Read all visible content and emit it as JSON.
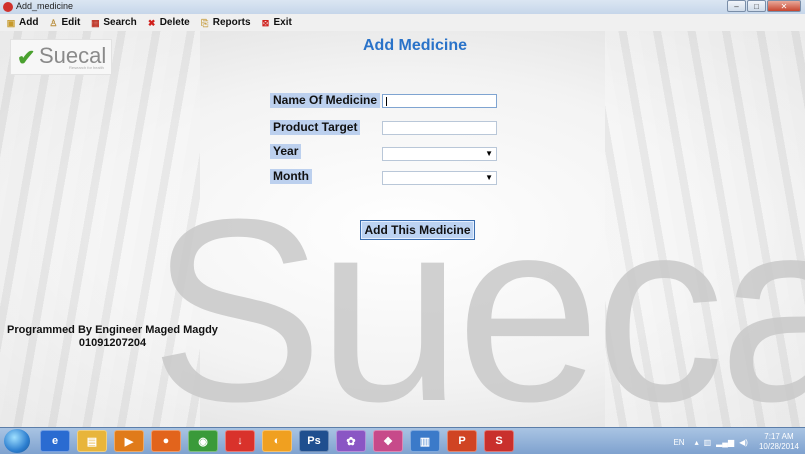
{
  "window": {
    "title": "Add_medicine",
    "controls": {
      "minimize": "–",
      "maximize": "□",
      "close": "✕"
    }
  },
  "menu": [
    {
      "label": "Add",
      "icon": "add-icon",
      "glyph": "▣",
      "color": "#c79a2b"
    },
    {
      "label": "Edit",
      "icon": "edit-icon",
      "glyph": "♙",
      "color": "#b98d3a"
    },
    {
      "label": "Search",
      "icon": "search-icon",
      "glyph": "▦",
      "color": "#c0392b"
    },
    {
      "label": "Delete",
      "icon": "delete-icon",
      "glyph": "✖",
      "color": "#d0201c"
    },
    {
      "label": "Reports",
      "icon": "reports-icon",
      "glyph": "⎘",
      "color": "#c9a24a"
    },
    {
      "label": "Exit",
      "icon": "exit-icon",
      "glyph": "⊠",
      "color": "#d0201c"
    }
  ],
  "logo": {
    "text": "Suecal",
    "tagline": "Research for health"
  },
  "form": {
    "title": "Add Medicine",
    "fields": {
      "name": {
        "label": "Name Of Medicine",
        "value": ""
      },
      "target": {
        "label": "Product Target",
        "value": ""
      },
      "year": {
        "label": "Year",
        "value": ""
      },
      "month": {
        "label": "Month",
        "value": ""
      }
    },
    "submit_label": "Add This Medicine"
  },
  "watermark": "Suecal",
  "credit": {
    "line1": "Programmed By Engineer Maged Magdy",
    "line2": "01091207204"
  },
  "taskbar": {
    "apps": [
      {
        "name": "taskbar-ie-icon",
        "glyph": "e",
        "color": "#2a6bd1"
      },
      {
        "name": "taskbar-explorer-icon",
        "glyph": "▤",
        "color": "#e8b53b"
      },
      {
        "name": "taskbar-media-icon",
        "glyph": "▶",
        "color": "#e07b1a"
      },
      {
        "name": "taskbar-firefox-icon",
        "glyph": "●",
        "color": "#e2641c"
      },
      {
        "name": "taskbar-chrome-icon",
        "glyph": "◉",
        "color": "#3a9a3a"
      },
      {
        "name": "taskbar-download-icon",
        "glyph": "↓",
        "color": "#d9322b"
      },
      {
        "name": "taskbar-app-icon",
        "glyph": "◐",
        "color": "#f0a020"
      },
      {
        "name": "taskbar-photoshop-icon",
        "glyph": "Ps",
        "color": "#1f4f8f"
      },
      {
        "name": "taskbar-messenger-icon",
        "glyph": "✿",
        "color": "#8a56c4"
      },
      {
        "name": "taskbar-paint-icon",
        "glyph": "❖",
        "color": "#c74a8a"
      },
      {
        "name": "taskbar-remote-icon",
        "glyph": "▥",
        "color": "#3b7ac9"
      },
      {
        "name": "taskbar-powerpoint-icon",
        "glyph": "P",
        "color": "#d04423"
      },
      {
        "name": "taskbar-suecal-icon",
        "glyph": "S",
        "color": "#c9302c"
      }
    ],
    "lang": "EN",
    "time": "7:17 AM",
    "date": "10/28/2014"
  }
}
